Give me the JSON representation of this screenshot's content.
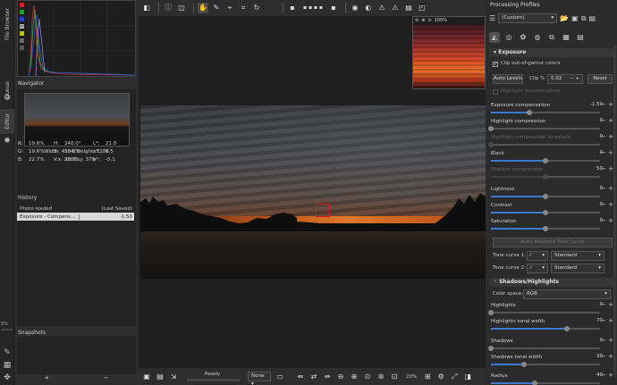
{
  "left_tabs": [
    "File Browser",
    "Queue",
    "Editor"
  ],
  "navigator": {
    "title": "Navigator",
    "size_text": "Width: 4504, Height: 2286",
    "coords": "x: 3868, y: 379",
    "values": [
      [
        "R:",
        "19.6%",
        "H:",
        "240.0°",
        "L*:",
        "21.0"
      ],
      [
        "G:",
        "19.6%",
        "S:",
        "13.8%",
        "a*:",
        "1.5"
      ],
      [
        "B:",
        "22.7%",
        "V:",
        "22.7%",
        "b*:",
        "-5.1"
      ]
    ]
  },
  "history": {
    "title": "History",
    "rows": [
      {
        "name": "Photo loaded",
        "value": "(Last Saved)"
      },
      {
        "name": "Exposure - Compens...",
        "value": "-1.50"
      }
    ]
  },
  "progress_pct": "0%",
  "snapshots": {
    "title": "Snapshots",
    "add": "+",
    "remove": "−"
  },
  "preview": {
    "zoom": "100%"
  },
  "bottom": {
    "status": "Ready",
    "mode": "None",
    "zoom": "20%"
  },
  "right": {
    "title": "Processing Profiles",
    "profile": "(Custom)",
    "exposure": {
      "header": "Exposure",
      "clip_label": "Clip out-of-gamut colors",
      "auto_levels": "Auto Levels",
      "clip_pct_label": "Clip %",
      "clip_pct_value": "0.02",
      "reset": "Reset",
      "highlight_recon": "Highlight reconstruction",
      "sliders": [
        {
          "label": "Exposure compensation",
          "value": "-1.50",
          "pos": 0.35,
          "dim": false
        },
        {
          "label": "Highlight compression",
          "value": "0",
          "pos": 0.0,
          "dim": false
        },
        {
          "label": "Highlight compression threshold",
          "value": "0",
          "pos": 0.0,
          "dim": true
        },
        {
          "label": "Black",
          "value": "0",
          "pos": 0.5,
          "dim": false
        },
        {
          "label": "Shadow compression",
          "value": "50",
          "pos": 0.5,
          "dim": true
        },
        {
          "label": "Lightness",
          "value": "0",
          "pos": 0.5,
          "dim": false
        },
        {
          "label": "Contrast",
          "value": "0",
          "pos": 0.5,
          "dim": false
        },
        {
          "label": "Saturation",
          "value": "0",
          "pos": 0.5,
          "dim": false
        }
      ],
      "auto_tone": "Auto-Matched Tone Curve",
      "tone1_label": "Tone curve 1:",
      "tone2_label": "Tone curve 2:",
      "tone_mode": "Standard"
    },
    "shadows": {
      "header": "Shadows/Highlights",
      "colorspace_label": "Color space:",
      "colorspace": "RGB",
      "sliders": [
        {
          "label": "Highlights",
          "value": "0",
          "pos": 0.0
        },
        {
          "label": "Highlights tonal width",
          "value": "70",
          "pos": 0.7
        },
        {
          "label": "Shadows",
          "value": "0",
          "pos": 0.0
        },
        {
          "label": "Shadows tonal width",
          "value": "30",
          "pos": 0.3
        },
        {
          "label": "Radius",
          "value": "40",
          "pos": 0.4
        }
      ]
    }
  }
}
